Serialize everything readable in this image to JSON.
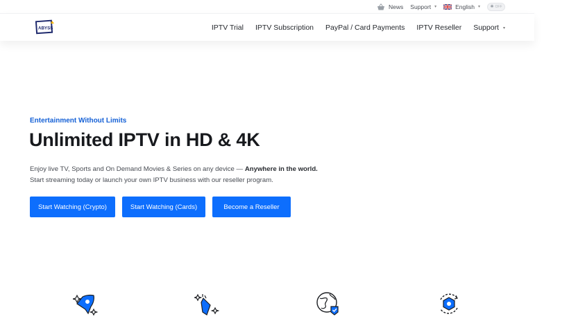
{
  "topbar": {
    "news": "News",
    "support": "Support",
    "language": "English",
    "toggle_label": "OFF"
  },
  "brand": {
    "logo_text": "ABYSS"
  },
  "nav": {
    "items": [
      {
        "label": "IPTV Trial"
      },
      {
        "label": "IPTV Subscription"
      },
      {
        "label": "PayPal / Card Payments"
      },
      {
        "label": "IPTV Reseller"
      },
      {
        "label": "Support"
      }
    ]
  },
  "hero": {
    "eyebrow": "Entertainment Without Limits",
    "title": "Unlimited IPTV in HD & 4K",
    "desc_line1_start": "Enjoy live TV, Sports and On Demand Movies & Series on any device — ",
    "desc_line1_bold": "Anywhere in the world.",
    "desc_line2": "Start streaming today or launch your own IPTV business with our reseller program.",
    "buttons": [
      {
        "label": "Start Watching (Crypto)"
      },
      {
        "label": "Start Watching (Cards)"
      },
      {
        "label": "Become a Reseller"
      }
    ]
  },
  "colors": {
    "accent": "#0d6efd",
    "eyebrow": "#1460d6"
  },
  "features": {
    "icons": [
      "rocket-icon",
      "magic-wand-icon",
      "globe-check-icon",
      "refresh-shield-icon"
    ]
  }
}
